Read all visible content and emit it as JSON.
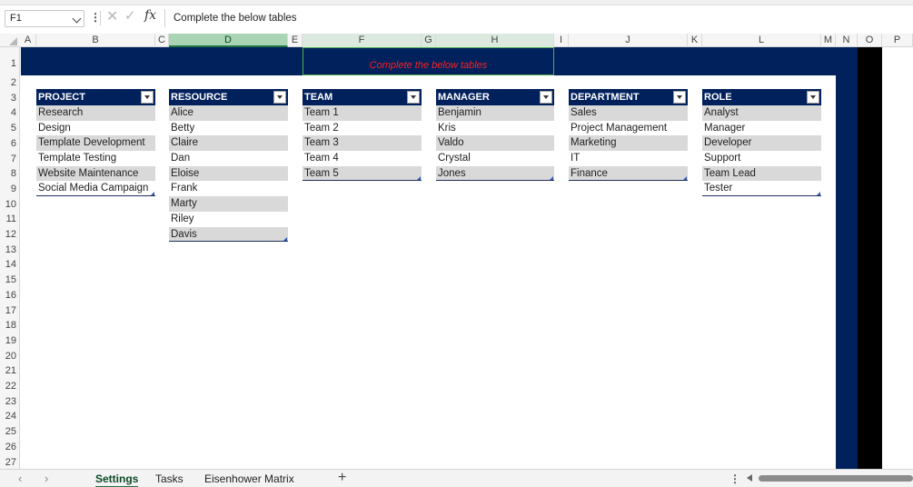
{
  "formula_bar": {
    "name_box": "F1",
    "formula": "Complete the below tables"
  },
  "columns": [
    "A",
    "B",
    "C",
    "D",
    "E",
    "F",
    "G",
    "H",
    "I",
    "J",
    "K",
    "L",
    "M",
    "N",
    "O",
    "P"
  ],
  "rows": [
    "1",
    "2",
    "3",
    "4",
    "5",
    "6",
    "7",
    "8",
    "9",
    "10",
    "11",
    "12",
    "13",
    "14",
    "15",
    "16",
    "17",
    "18",
    "19",
    "20",
    "21",
    "22",
    "23",
    "24",
    "25",
    "26",
    "27"
  ],
  "banner": {
    "text": "Complete the below tables"
  },
  "tables": {
    "project": {
      "header": "PROJECT",
      "items": [
        "Research",
        "Design",
        "Template Development",
        "Template Testing",
        "Website Maintenance",
        "Social Media Campaign"
      ]
    },
    "resource": {
      "header": "RESOURCE",
      "items": [
        "Alice",
        "Betty",
        "Claire",
        "Dan",
        "Eloise",
        "Frank",
        "Marty",
        "Riley",
        "Davis"
      ]
    },
    "team": {
      "header": "TEAM",
      "items": [
        "Team 1",
        "Team 2",
        "Team 3",
        "Team 4",
        "Team 5"
      ]
    },
    "manager": {
      "header": "MANAGER",
      "items": [
        "Benjamin",
        "Kris",
        "Valdo",
        "Crystal",
        "Jones"
      ]
    },
    "department": {
      "header": "DEPARTMENT",
      "items": [
        "Sales",
        "Project Management",
        "Marketing",
        "IT",
        "Finance"
      ]
    },
    "role": {
      "header": "ROLE",
      "items": [
        "Analyst",
        "Manager",
        "Developer",
        "Support",
        "Team Lead",
        "Tester"
      ]
    }
  },
  "sheet_tabs": {
    "settings": "Settings",
    "tasks": "Tasks",
    "eisenhower": "Eisenhower Matrix",
    "active": "Settings"
  },
  "colors": {
    "header_navy": "#00215c",
    "banner_text": "#ff1f1f",
    "band_gray": "#d9d9d9",
    "excel_green": "#217346"
  }
}
